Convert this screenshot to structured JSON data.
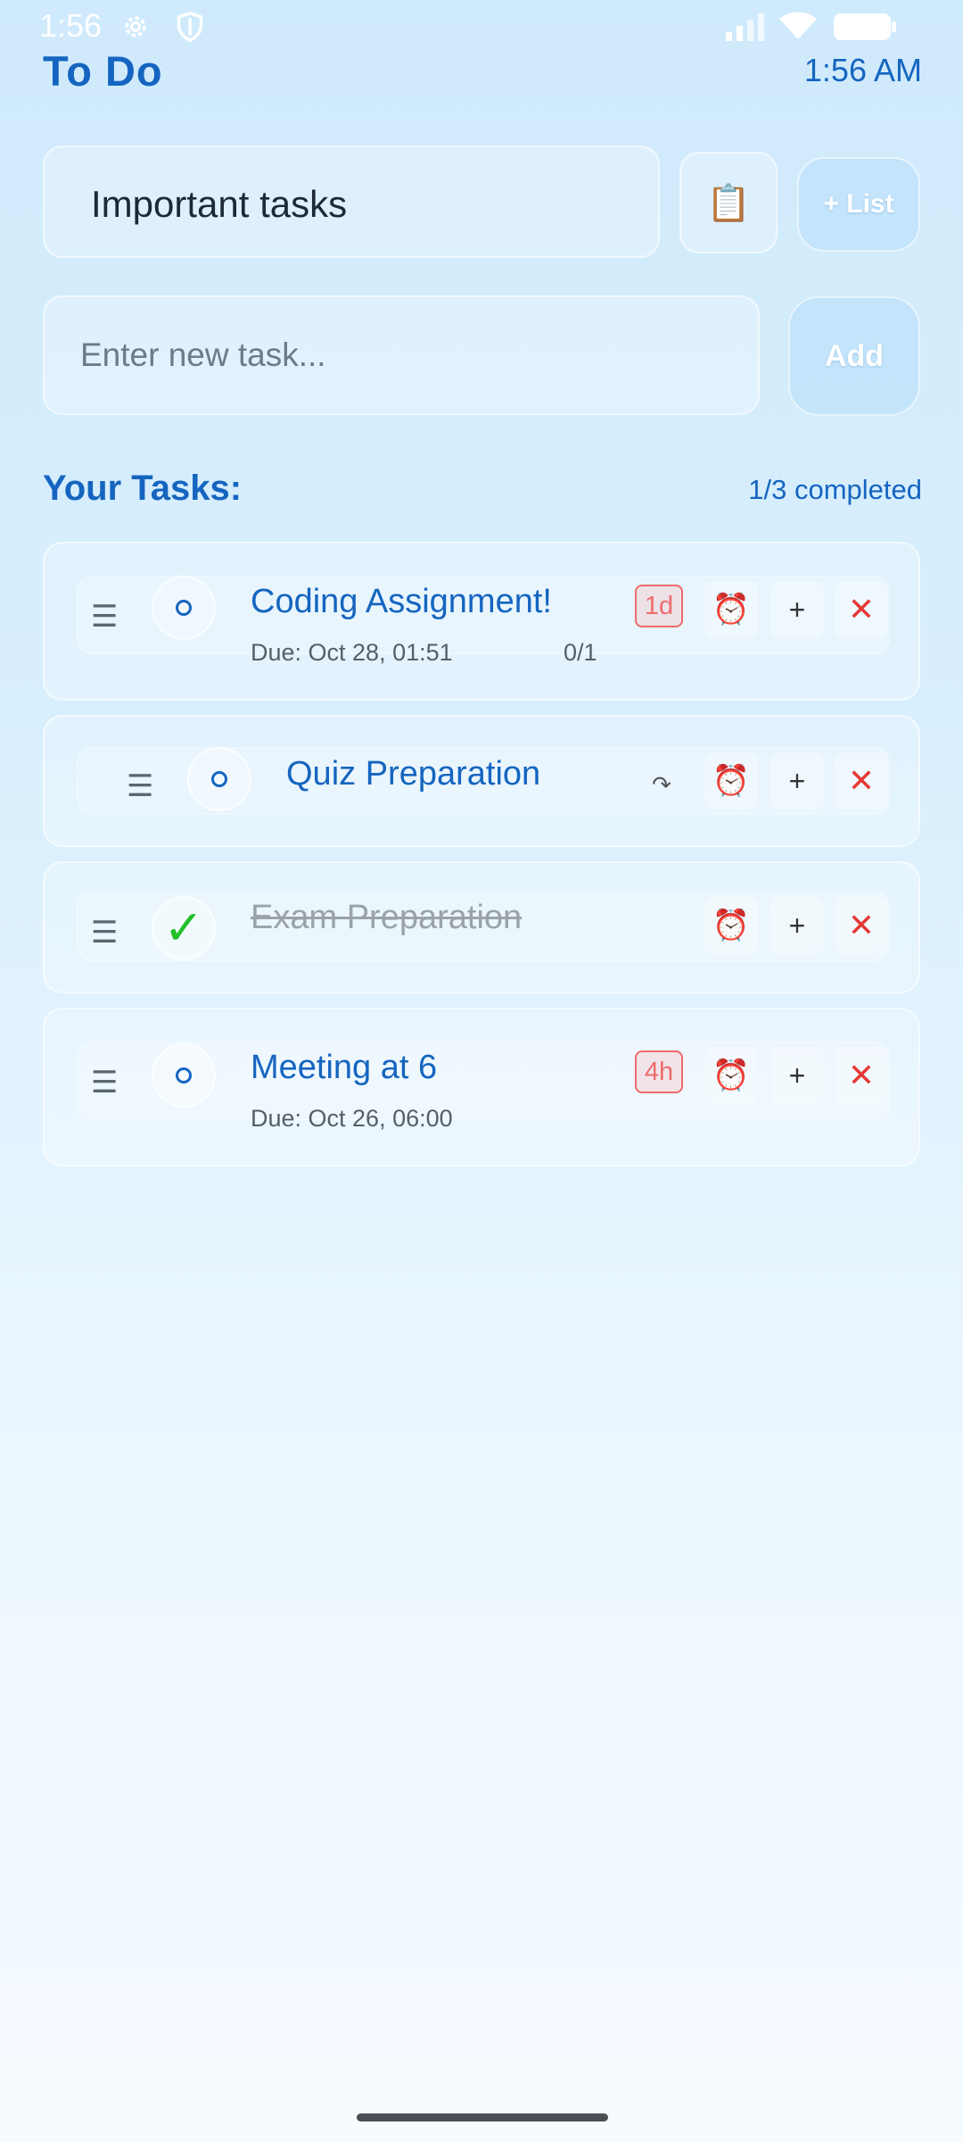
{
  "status_bar": {
    "time": "1:56",
    "icons": [
      "gear-icon",
      "shield-icon",
      "signal-icon",
      "wifi-icon",
      "battery-icon"
    ]
  },
  "header": {
    "title": "To Do",
    "clock": "1:56 AM"
  },
  "list_selector": {
    "current": "Important tasks",
    "clipboard_icon": "📋",
    "new_list_label": "+ List"
  },
  "new_task": {
    "placeholder": "Enter new task...",
    "add_label": "Add"
  },
  "tasks_section": {
    "title": "Your Tasks:",
    "progress": "1/3 completed"
  },
  "tasks": [
    {
      "title": "Coding Assignment!",
      "due": "Due: Oct 28, 01:51",
      "subtasks": "0/1",
      "badge": "1d",
      "completed": false
    },
    {
      "title": "Quiz Preparation",
      "repeat_icon": "↷",
      "completed": false
    },
    {
      "title": "Exam Preparation",
      "completed": true
    },
    {
      "title": "Meeting at 6",
      "due": "Due: Oct 26, 06:00",
      "badge": "4h",
      "completed": false
    }
  ],
  "actions": {
    "drag": "☰",
    "alarm": "⏰",
    "plus": "+",
    "delete": "✕",
    "check": "✓"
  },
  "colors": {
    "accent": "#1565c0",
    "danger": "#e53935",
    "done_green": "#22c02a",
    "badge": "#ef6b6b"
  }
}
